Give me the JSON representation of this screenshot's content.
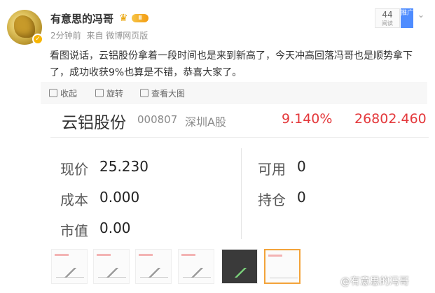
{
  "user": {
    "name": "有意思的冯哥",
    "vip_level": "Ⅱ",
    "verified": true
  },
  "meta": {
    "time": "2分钟前",
    "source": "来自 微博网页版"
  },
  "read": {
    "count": "44",
    "label": "阅读"
  },
  "promo_tag": "推广",
  "post": {
    "text": "看图说话，云铝股份拿着一段时间也是来到新高了，今天冲高回落冯哥也是顺势拿下了，成功收获9%也算是不错，恭喜大家了。"
  },
  "toolbar": {
    "collapse": "收起",
    "rotate": "旋转",
    "view_large": "查看大图"
  },
  "stock": {
    "name": "云铝股份",
    "code": "000807",
    "market": "深圳A股",
    "change_pct": "9.140%",
    "value": "26802.460",
    "fields": {
      "current_price_label": "现价",
      "current_price": "25.230",
      "cost_label": "成本",
      "cost": "0.000",
      "market_value_label": "市值",
      "market_value": "0.00",
      "available_label": "可用",
      "available": "0",
      "position_label": "持仓",
      "position": "0"
    }
  },
  "watermark": "@有意思的冯哥",
  "colors": {
    "accent_red": "#e4393c",
    "vip_gold": "#f39c12",
    "promo_blue": "#4e8cff"
  },
  "icons": {
    "collapse": "collapse-icon",
    "rotate": "rotate-icon",
    "view_large": "zoom-icon",
    "dropdown": "chevron-down-icon"
  }
}
